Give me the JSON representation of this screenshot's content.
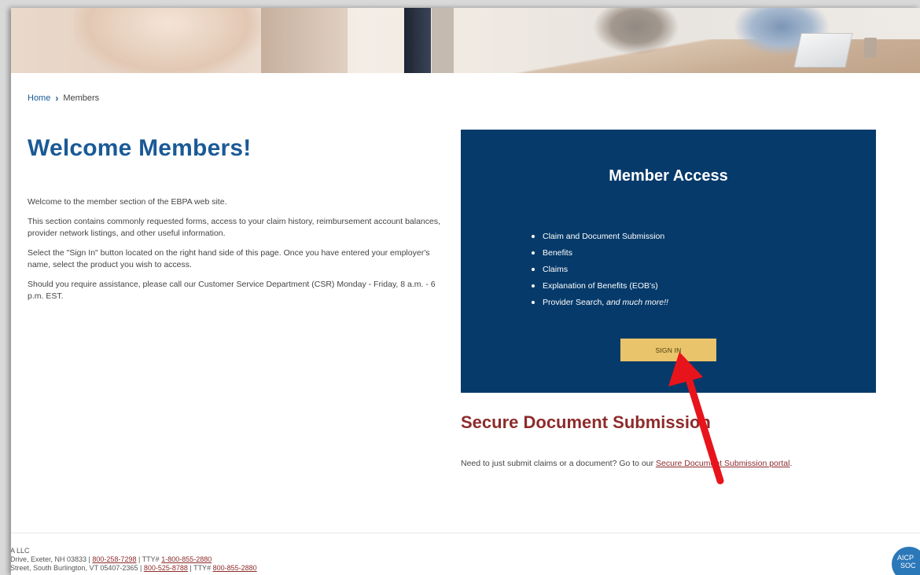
{
  "breadcrumb": {
    "home": "Home",
    "separator": "›",
    "current": "Members"
  },
  "page_title": "Welcome Members!",
  "intro": [
    "Welcome to the member section of the EBPA web site.",
    "This section contains commonly requested forms, access to your claim history, reimbursement account balances, provider network listings, and other useful information.",
    "Select the \"Sign In\" button located on the right hand side of this page. Once you have entered your employer's name, select the product you wish to access.",
    "Should you require assistance, please call our Customer Service Department (CSR) Monday - Friday, 8 a.m. - 6 p.m. EST."
  ],
  "member_access": {
    "title": "Member Access",
    "items": [
      "Claim and Document Submission",
      "Benefits",
      "Claims",
      "Explanation of Benefits (EOB's)"
    ],
    "last_item_prefix": "Provider Search,",
    "last_item_emphasis": "and much more!!",
    "signin_label": "SIGN IN"
  },
  "secure": {
    "title": "Secure Document Submission",
    "text_prefix": "Need to just submit claims or a document? Go to our",
    "link_label": "Secure Document Submission portal",
    "text_suffix": "."
  },
  "footer": {
    "company": "A LLC",
    "line1_address": "Drive, Exeter, NH 03833 |",
    "line1_phone": "800-258-7298",
    "line1_tty_label": "| TTY#",
    "line1_tty": "1-800-855-2880",
    "line2_address": "Street, South Burlington, VT 05407-2365 |",
    "line2_phone": "800-525-8788",
    "line2_tty_label": "| TTY#",
    "line2_tty": "800-855-2880",
    "badge_line1": "AICP",
    "badge_line2": "SOC"
  },
  "colors": {
    "brand_blue": "#1a5a96",
    "panel_navy": "#063a6a",
    "accent_red": "#8e2b2b",
    "button_gold": "#e9c46a",
    "annotation_arrow": "#e8141b"
  }
}
